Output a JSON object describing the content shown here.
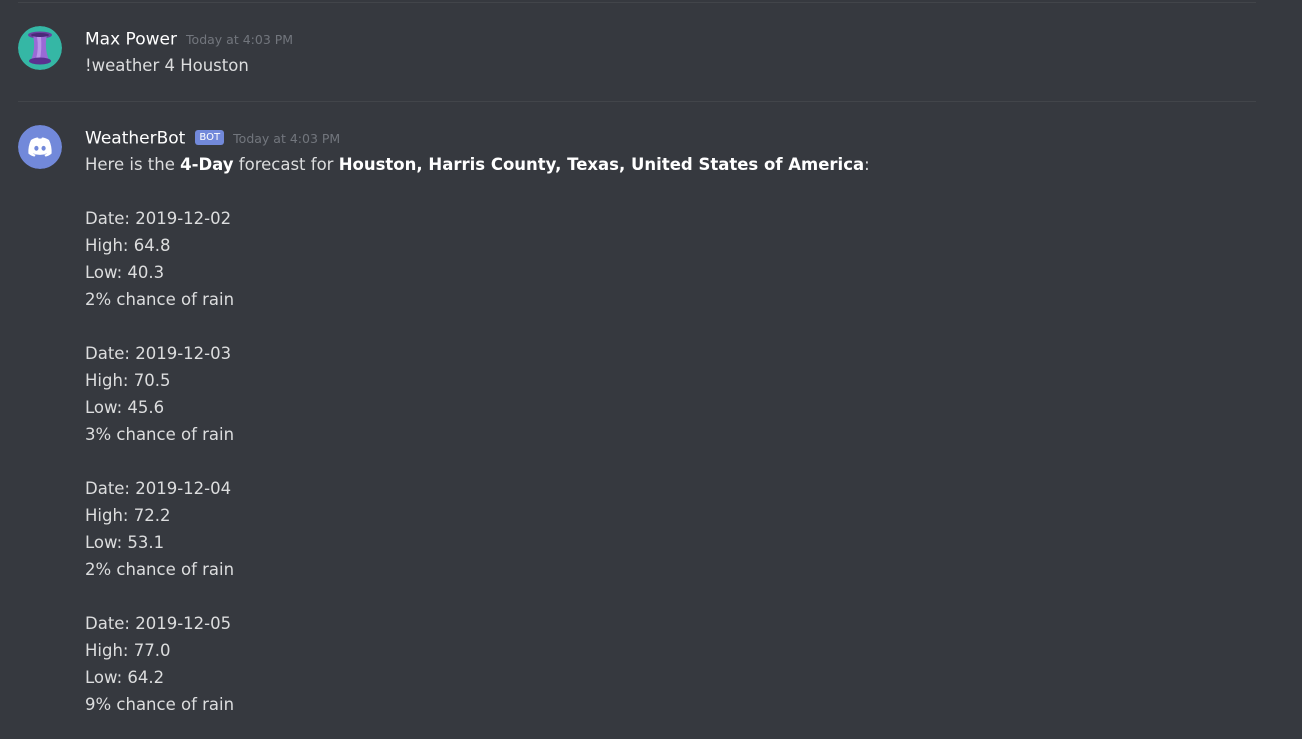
{
  "messages": [
    {
      "username": "Max Power",
      "timestamp": "Today at 4:03 PM",
      "text": "!weather 4 Houston",
      "avatar_icon": "top-hat-avatar"
    },
    {
      "username": "WeatherBot",
      "bot_tag": "BOT",
      "timestamp": "Today at 4:03 PM",
      "avatar_icon": "discord-logo-avatar",
      "intro": {
        "prefix": "Here is the ",
        "duration": "4-Day",
        "middle": " forecast for ",
        "location": "Houston, Harris County, Texas, United States of America",
        "suffix": ":"
      },
      "forecast": [
        {
          "date": "Date: 2019-12-02",
          "high": "High:  64.8",
          "low": "Low:  40.3",
          "rain": "2% chance of rain"
        },
        {
          "date": "Date: 2019-12-03",
          "high": "High:  70.5",
          "low": "Low:  45.6",
          "rain": "3% chance of rain"
        },
        {
          "date": "Date: 2019-12-04",
          "high": "High:  72.2",
          "low": "Low:  53.1",
          "rain": "2% chance of rain"
        },
        {
          "date": "Date: 2019-12-05",
          "high": "High:  77.0",
          "low": "Low:  64.2",
          "rain": "9% chance of rain"
        }
      ]
    }
  ],
  "colors": {
    "background": "#36393f",
    "username": "#ffffff",
    "message_text": "#dcddde",
    "timestamp": "#72767d",
    "bot_tag": "#7289da",
    "user_avatar_bg": "#35b7a5",
    "bot_avatar_bg": "#7289da"
  }
}
